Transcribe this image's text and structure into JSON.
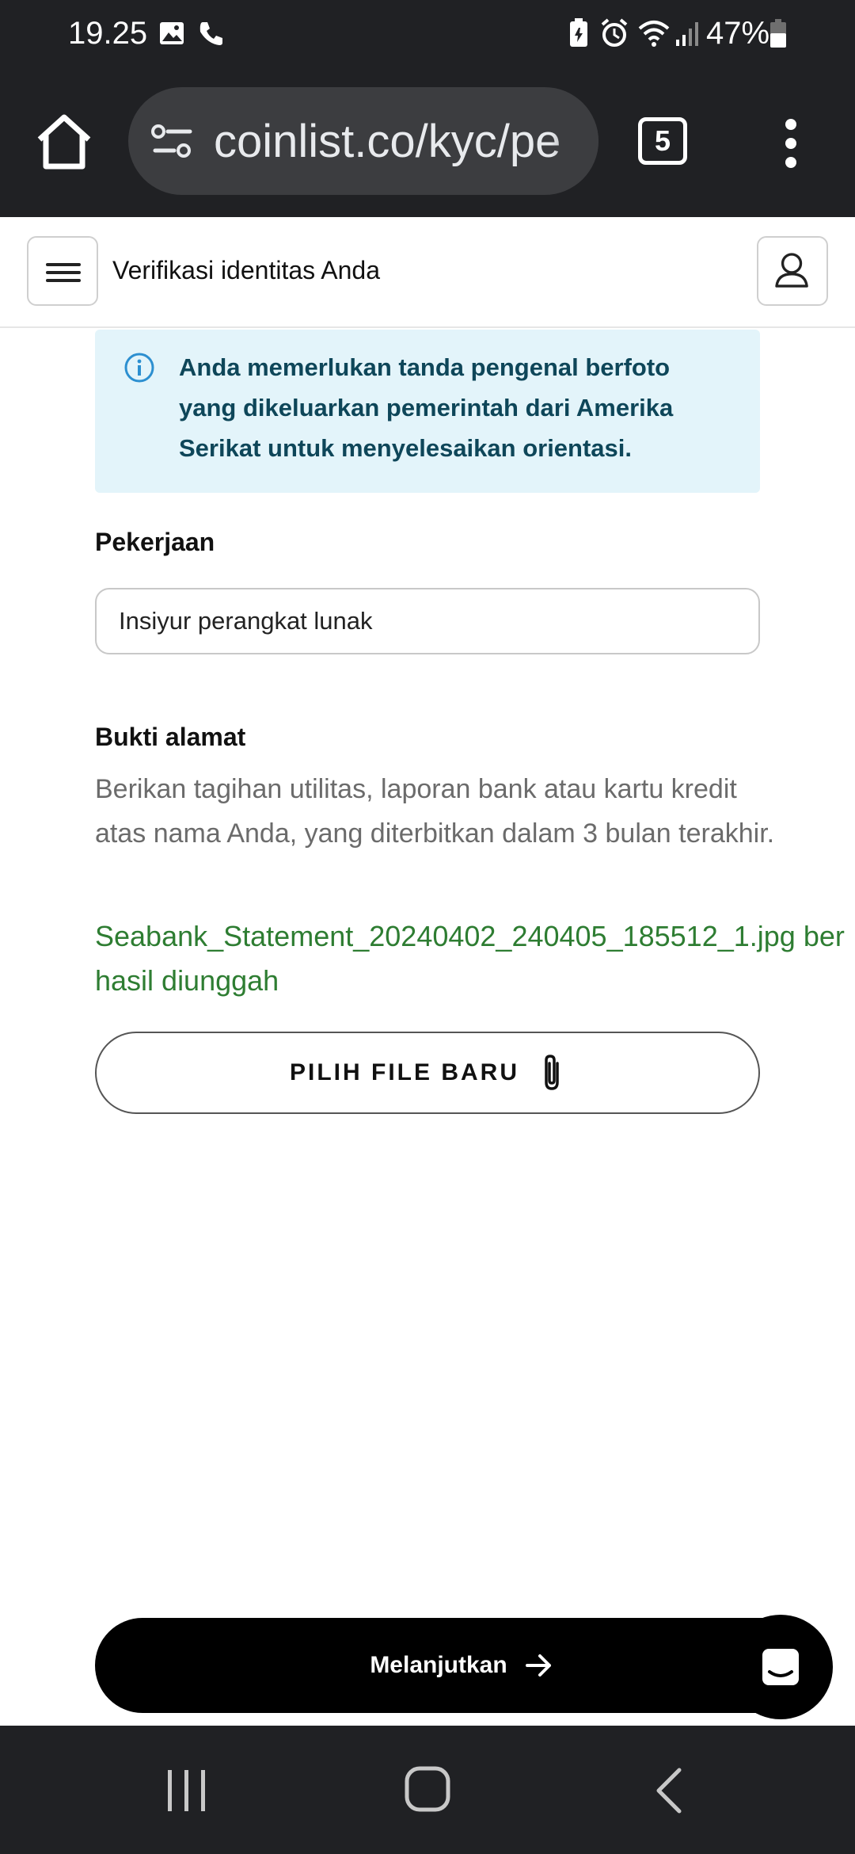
{
  "status_bar": {
    "time": "19.25",
    "battery": "47%",
    "icons": [
      "gallery-icon",
      "phone-icon",
      "battery-saver-icon",
      "alarm-icon",
      "wifi-icon",
      "signal-icon",
      "battery-icon"
    ]
  },
  "browser": {
    "url": "coinlist.co/kyc/pe",
    "tab_count": "5",
    "icons": [
      "home-icon",
      "site-settings-icon",
      "more-vert-icon"
    ]
  },
  "header": {
    "title": "Verifikasi identitas Anda",
    "icons": [
      "hamburger-menu-icon",
      "user-profile-icon"
    ]
  },
  "alert": {
    "text": "Anda memerlukan tanda pengenal berfoto yang dikeluarkan pemerintah dari Amerika Serikat untuk menyelesaikan orientasi.",
    "icon": "info-icon"
  },
  "occupation": {
    "label": "Pekerjaan",
    "value": "Insiyur perangkat lunak"
  },
  "proof_of_address": {
    "label": "Bukti alamat",
    "help": "Berikan tagihan utilitas, laporan bank atau kartu kredit atas nama Anda, yang diterbitkan dalam 3 bulan terakhir.",
    "success": "Seabank_Statement_20240402_240405_185512_1.jpg berhasil diunggah",
    "button_label": "PILIH FILE BARU",
    "button_icon": "paperclip-icon"
  },
  "continue_button": {
    "label": "Melanjutkan",
    "icon": "arrow-right-icon"
  },
  "chat": {
    "icon": "chat-icon"
  },
  "nav": {
    "icons": [
      "recent-apps-icon",
      "home-nav-icon",
      "back-icon"
    ]
  },
  "colors": {
    "system_bar": "#202124",
    "alert_bg": "#e3f4fa",
    "alert_text": "#0e4659",
    "info_blue": "#2c8fd0",
    "success_green": "#2e7d32",
    "primary_button": "#000000"
  }
}
